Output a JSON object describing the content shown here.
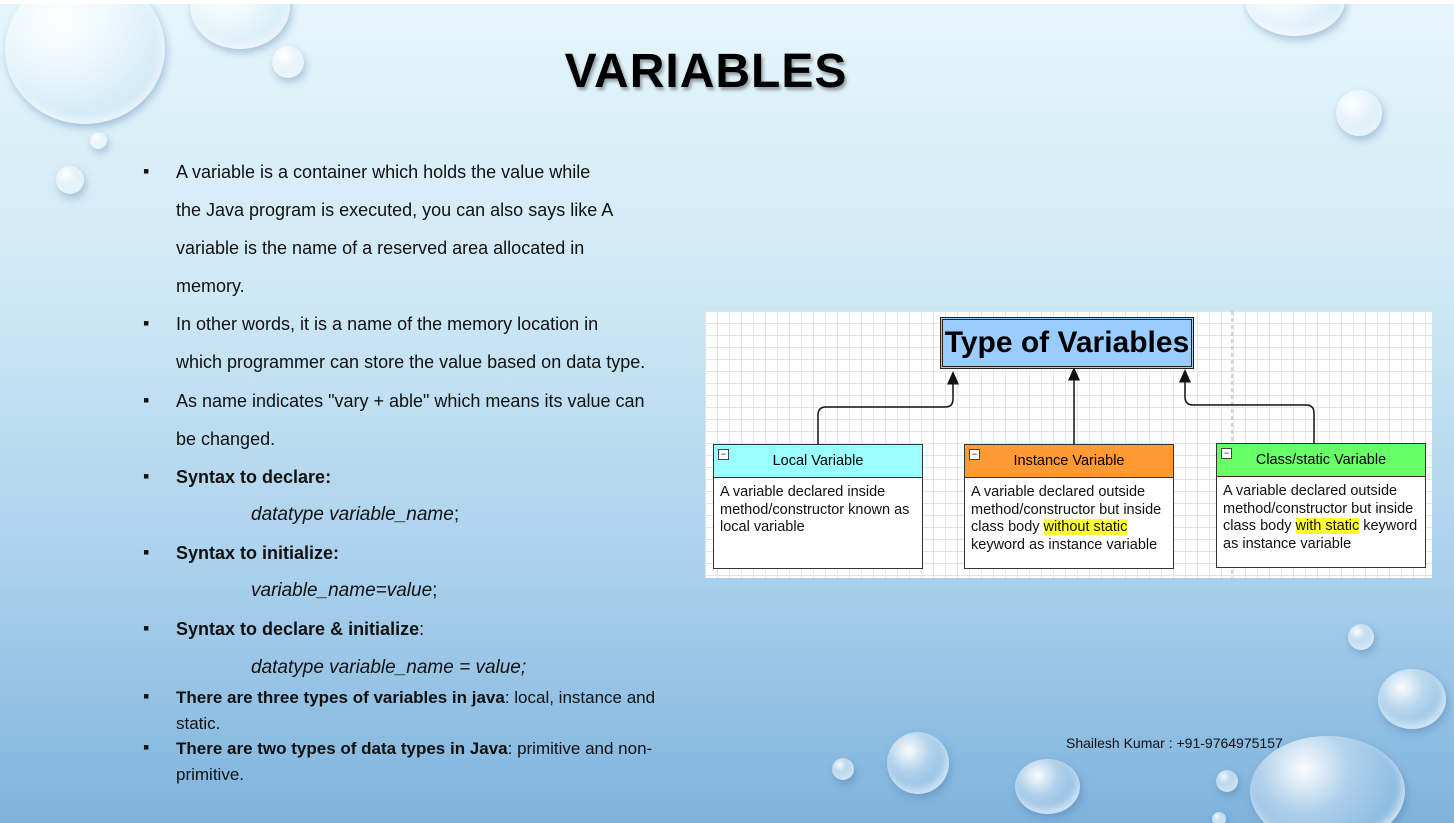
{
  "title": "VARIABLES",
  "bullets": {
    "b1_lines": [
      "A variable is a container which holds the value while",
      "the Java program is executed, you can also says like A",
      "variable is the name of a reserved area allocated in",
      "memory."
    ],
    "b2_lines": [
      "In other words, it is a name of the memory location in",
      "which programmer can store the value based on data type."
    ],
    "b3_lines": [
      "As name indicates \"vary + able\" which means its value can",
      "be changed."
    ],
    "b4_label": "Syntax to declare:",
    "b4_code": "datatype variable_name",
    "b4_code_end": ";",
    "b5_label": "Syntax to initialize:",
    "b5_code": "variable_name=value",
    "b5_code_end": ";",
    "b6_label": "Syntax to declare & initialize",
    "b6_colon": ":",
    "b6_code": "datatype variable_name = value;",
    "b7_bold": "There are three types of variables in java",
    "b7_rest": ": local, instance and static.",
    "b8_bold": "There are two types of data types in Java",
    "b8_rest": ": primitive and non-primitive."
  },
  "diagram": {
    "title": "Type of Variables",
    "boxes": [
      {
        "header": "Local Variable",
        "color": "#99ffff",
        "pre": "A variable declared inside method/constructor known as local variable",
        "highlight": "",
        "post": ""
      },
      {
        "header": "Instance Variable",
        "color": "#ff9933",
        "pre": "A variable declared outside method/constructor but inside class body ",
        "highlight": "without static",
        "post": " keyword as instance variable"
      },
      {
        "header": "Class/static Variable",
        "color": "#66ff66",
        "pre": "A variable declared outside method/constructor but inside class body ",
        "highlight": "with static",
        "post": " keyword as instance variable"
      }
    ],
    "minus_glyph": "−"
  },
  "footer": "Shailesh Kumar : +91-9764975157"
}
